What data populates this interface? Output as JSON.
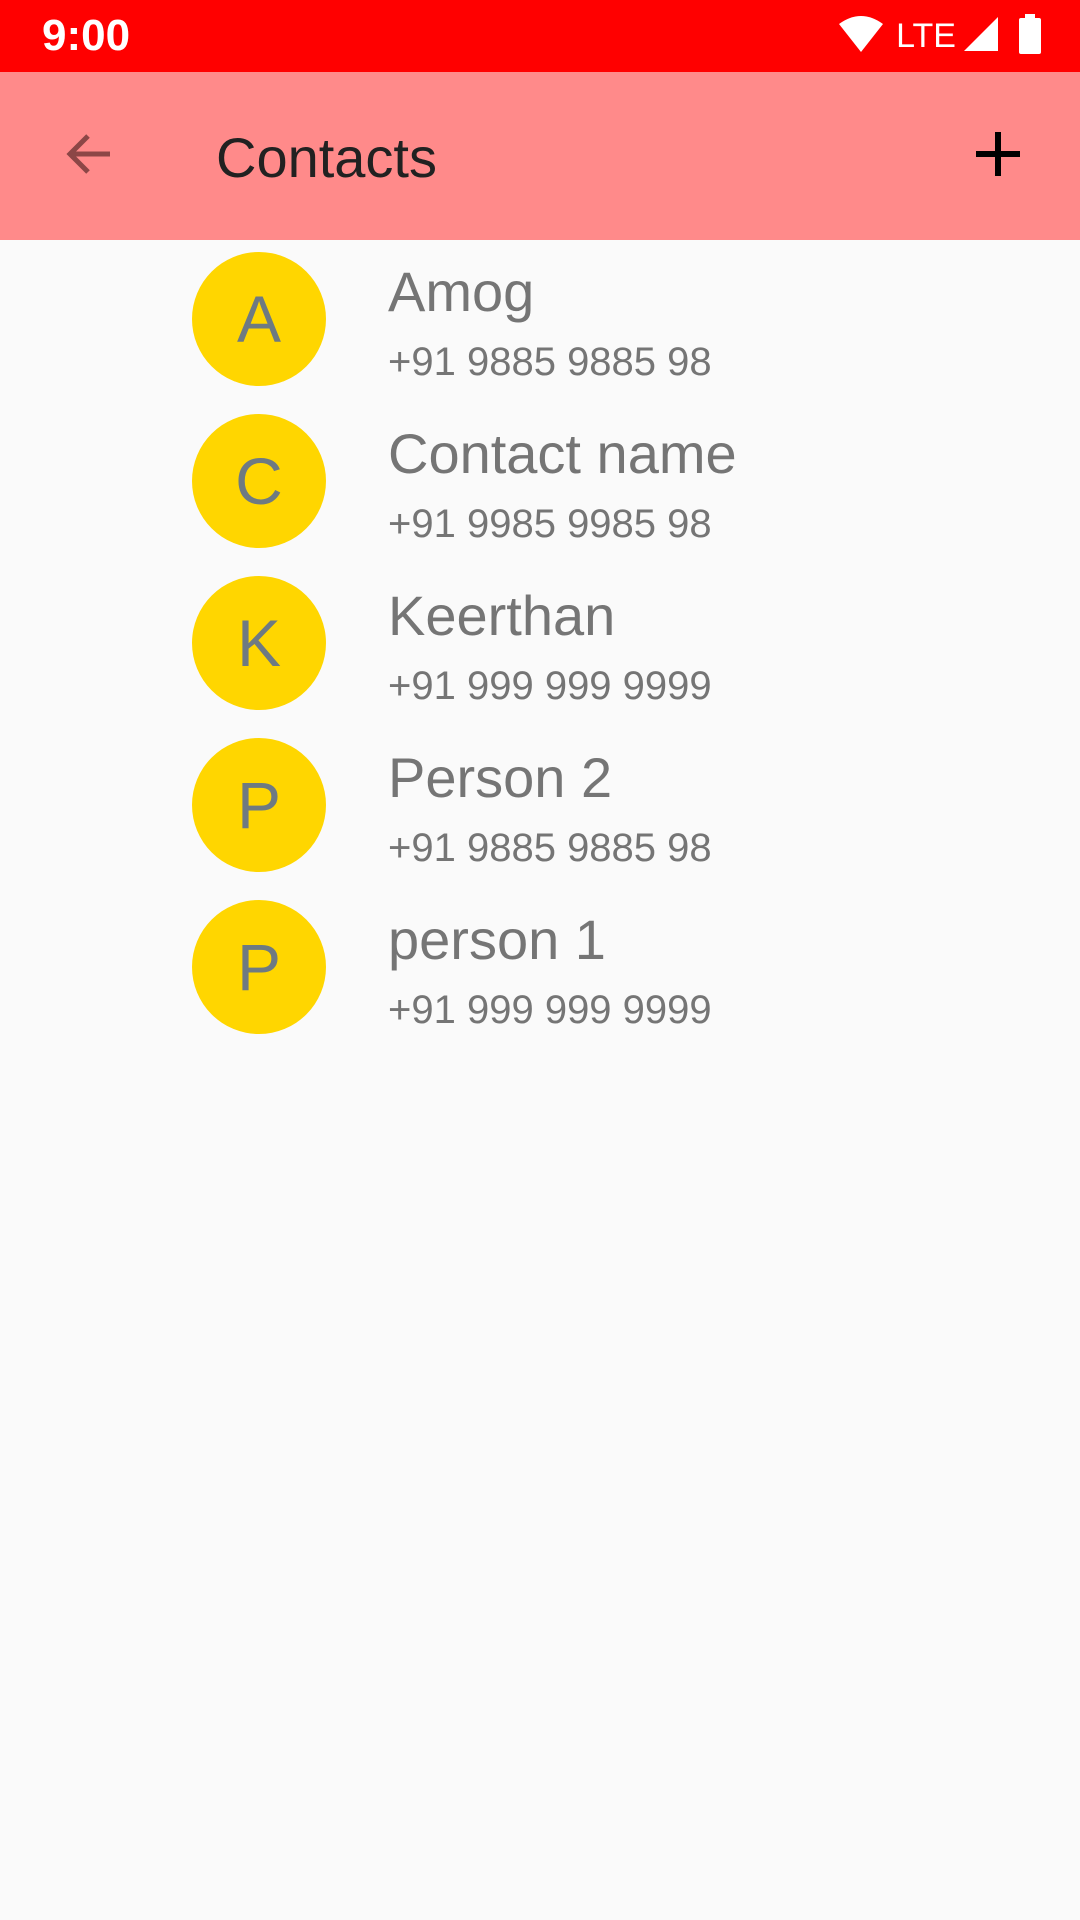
{
  "status_bar": {
    "time": "9:00",
    "network_label": "LTE",
    "icons": [
      "wifi-icon",
      "signal-icon",
      "battery-icon"
    ],
    "color": "#ff0000"
  },
  "app_bar": {
    "title": "Contacts",
    "back_icon": "arrow-back-icon",
    "add_icon": "plus-icon",
    "color": "#ff8a8a"
  },
  "contacts": [
    {
      "initial": "A",
      "name": "Amog",
      "phone": "+91 9885 9885 98"
    },
    {
      "initial": "C",
      "name": "Contact name",
      "phone": "+91 9985 9985 98"
    },
    {
      "initial": "K",
      "name": "Keerthan",
      "phone": "+91 999 999 9999"
    },
    {
      "initial": "P",
      "name": "Person 2",
      "phone": "+91 9885 9885 98"
    },
    {
      "initial": "P",
      "name": "person 1",
      "phone": "+91 999 999 9999"
    }
  ],
  "colors": {
    "avatar_background": "#ffd600",
    "avatar_text": "#6e7a82",
    "list_text": "#757575",
    "page_background": "#fafafa"
  }
}
